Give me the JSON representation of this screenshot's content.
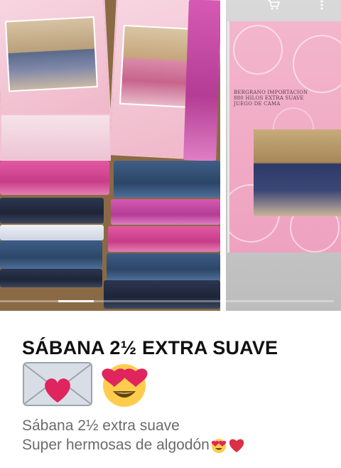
{
  "gallery": {
    "active_index": 0,
    "right_photo_box_text": "BERGRANO IMPORTACION\n880 HILOS EXTRA SUAVE\nJUEGO DE CAMA",
    "top_icons": [
      "cart-icon",
      "more-vert-icon"
    ]
  },
  "post": {
    "title": "SÁBANA 2½ EXTRA SUAVE",
    "title_emojis": [
      "love-letter-emoji",
      "heart-eyes-emoji"
    ],
    "description_line1": "Sábana 2½ extra suave",
    "description_line2": "Super hermosas de algodón",
    "description_line2_emojis": [
      "heart-eyes-emoji",
      "red-heart-emoji"
    ]
  },
  "colors": {
    "title": "#111111",
    "description": "#6b6b6b",
    "box_pink": "#f3b6cc",
    "sheet_pink": "#e25aa3",
    "sheet_denim": "#3f5d86"
  }
}
